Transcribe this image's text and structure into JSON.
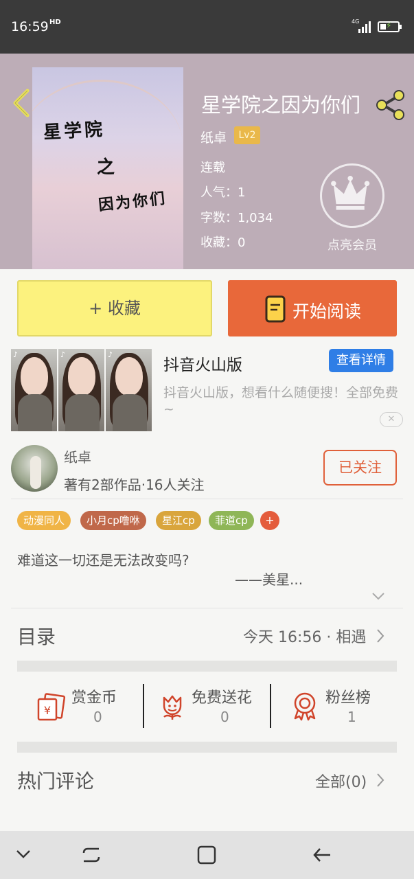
{
  "status_bar": {
    "time": "16:59",
    "hd": "HD",
    "network": "4G"
  },
  "book": {
    "title": "星学院之因为你们",
    "author": "纸卓",
    "level": "Lv2",
    "status": "连载",
    "popularity": "人气：1",
    "words": "字数：1,034",
    "favorites": "收藏：0",
    "cover_lines": [
      "星学院",
      "之",
      "因为你们"
    ]
  },
  "vip": {
    "label": "点亮会员"
  },
  "actions": {
    "collect": "+ 收藏",
    "read": "开始阅读"
  },
  "ad": {
    "title": "抖音火山版",
    "detail_button": "查看详情",
    "description": "抖音火山版，想看什么随便搜！全部免费~",
    "close": "✕"
  },
  "author_card": {
    "name": "纸卓",
    "stats": "著有2部作品·16人关注",
    "follow": "已关注"
  },
  "tags": [
    {
      "label": "动漫同人",
      "color": "#f0b446"
    },
    {
      "label": "小月cp噜咻",
      "color": "#c0684a"
    },
    {
      "label": "星江cp",
      "color": "#d9a53c"
    },
    {
      "label": "菲道cp",
      "color": "#8fb657"
    }
  ],
  "tag_more": "+",
  "synopsis": {
    "line1": "难道这一切还是无法改变吗?",
    "line2": "——美星..."
  },
  "toc": {
    "title": "目录",
    "latest": "今天 16:56 · 相遇"
  },
  "rewards": [
    {
      "label": "赏金币",
      "count": "0",
      "icon": "coin-envelope-icon"
    },
    {
      "label": "免费送花",
      "count": "0",
      "icon": "flower-icon"
    },
    {
      "label": "粉丝榜",
      "count": "1",
      "icon": "medal-icon"
    }
  ],
  "comments": {
    "title": "热门评论",
    "all": "全部(0)"
  },
  "colors": {
    "accent_orange": "#e8683a",
    "collect_yellow": "#fcf27e",
    "detail_blue": "#2f7ee6",
    "vip_badge": "#e9b84a"
  }
}
